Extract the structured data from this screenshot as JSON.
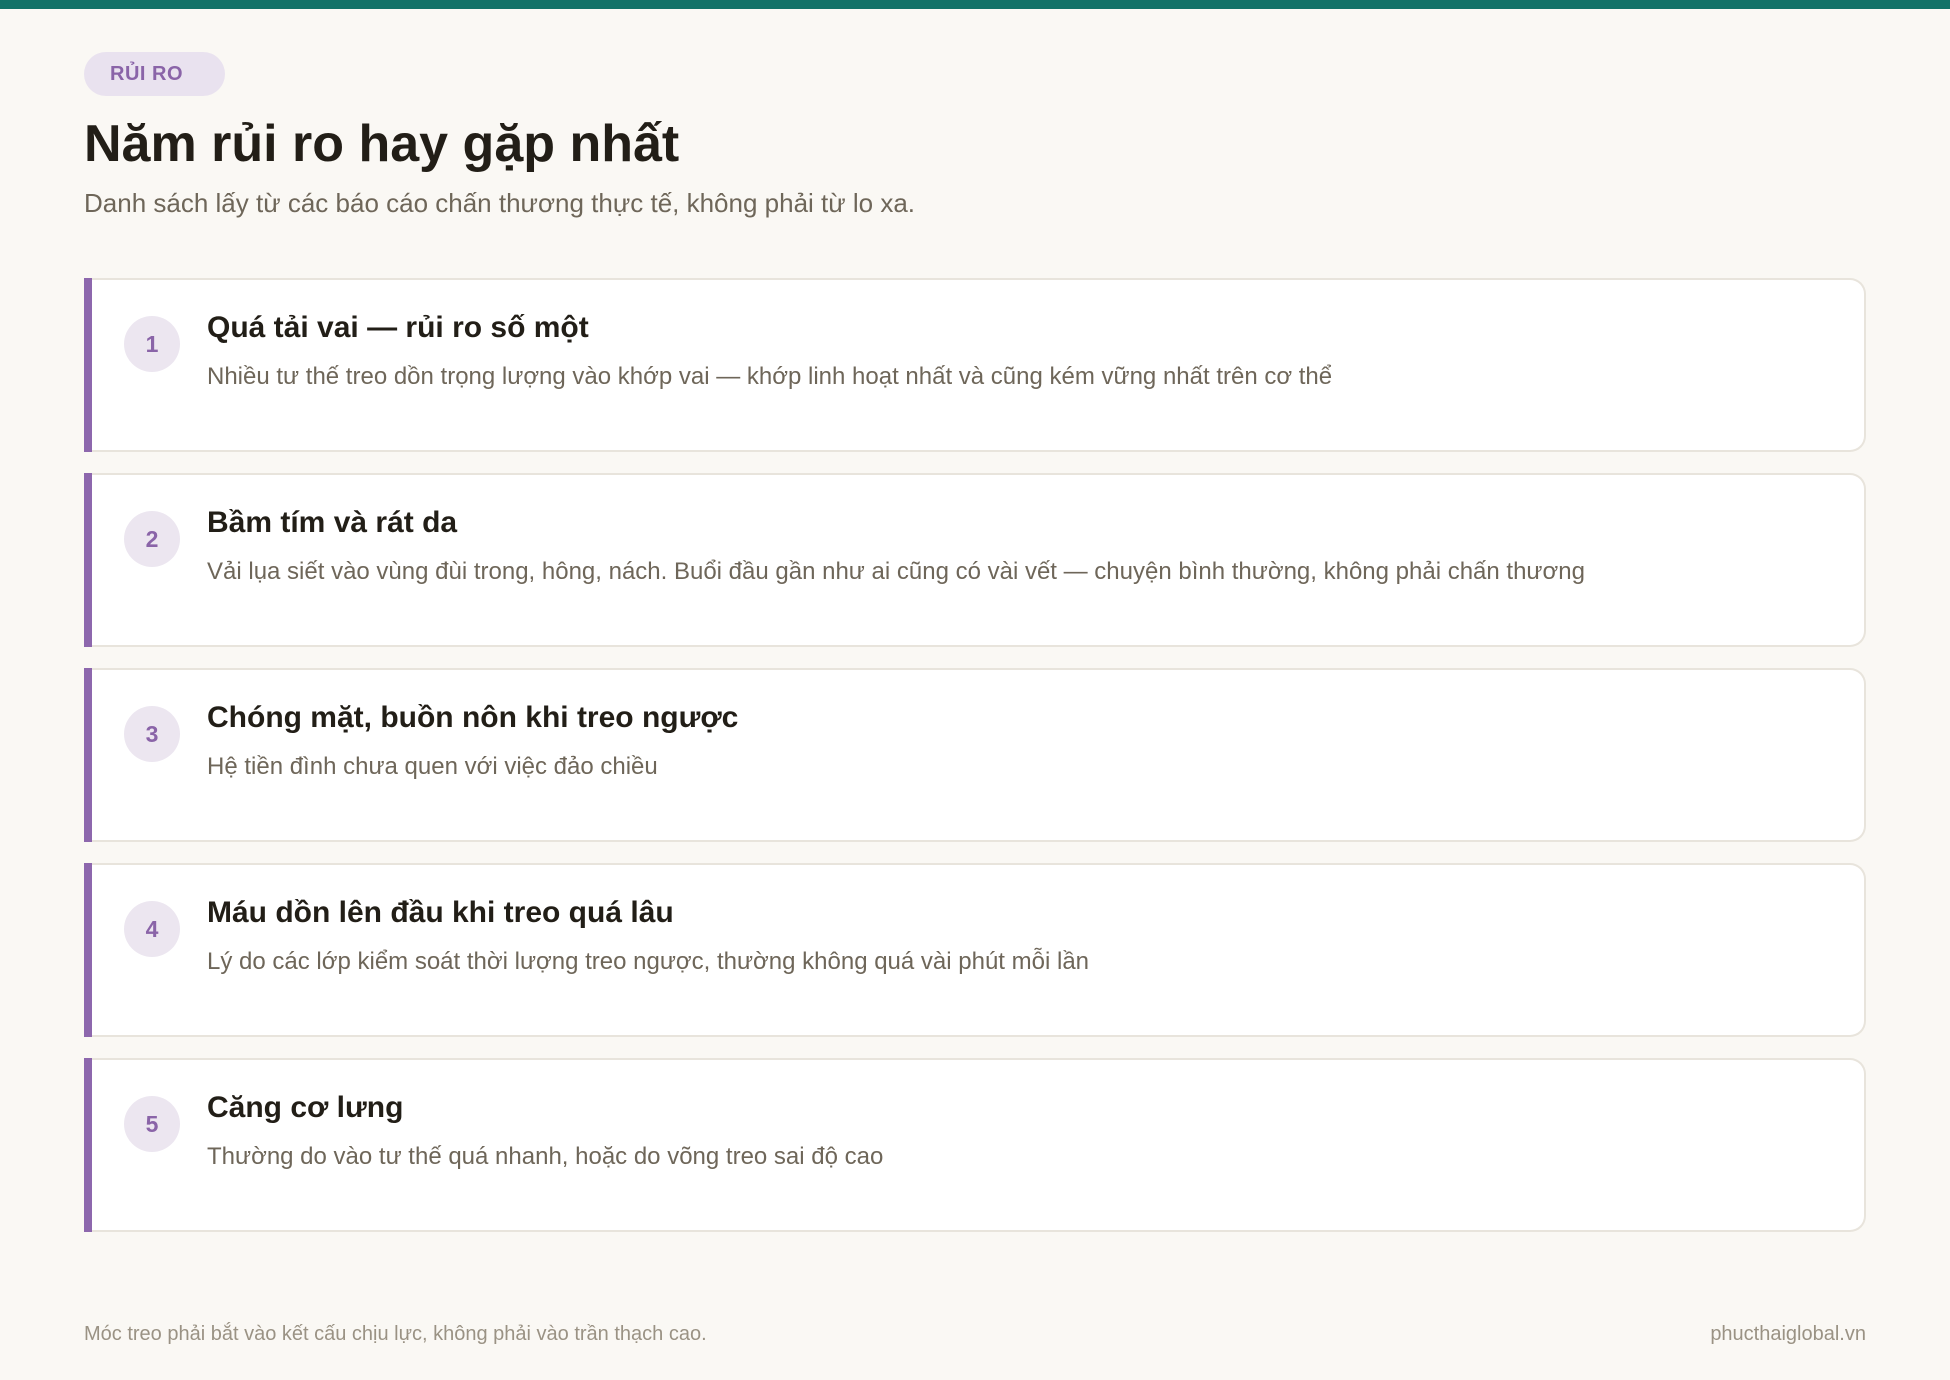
{
  "badge": "RỦI RO",
  "title": "Năm rủi ro hay gặp nhất",
  "subtitle": "Danh sách lấy từ các báo cáo chấn thương thực tế, không phải từ lo xa.",
  "risks": [
    {
      "number": "1",
      "title": "Quá tải vai — rủi ro số một",
      "description": "Nhiều tư thế treo dồn trọng lượng vào khớp vai — khớp linh hoạt nhất và cũng kém vững nhất trên cơ thể"
    },
    {
      "number": "2",
      "title": "Bầm tím và rát da",
      "description": "Vải lụa siết vào vùng đùi trong, hông, nách. Buổi đầu gần như ai cũng có vài vết — chuyện bình thường, không phải chấn thương"
    },
    {
      "number": "3",
      "title": "Chóng mặt, buồn nôn khi treo ngược",
      "description": "Hệ tiền đình chưa quen với việc đảo chiều"
    },
    {
      "number": "4",
      "title": "Máu dồn lên đầu khi treo quá lâu",
      "description": "Lý do các lớp kiểm soát thời lượng treo ngược, thường không quá vài phút mỗi lần"
    },
    {
      "number": "5",
      "title": "Căng cơ lưng",
      "description": "Thường do vào tư thế quá nhanh, hoặc do võng treo sai độ cao"
    }
  ],
  "footer": {
    "note": "Móc treo phải bắt vào kết cấu chịu lực, không phải vào trần thạch cao.",
    "site": "phucthaiglobal.vn"
  },
  "colors": {
    "top_bar": "#137268",
    "accent": "#8d67ad",
    "badge_bg": "#e9e2ef",
    "background": "#faf8f4"
  }
}
